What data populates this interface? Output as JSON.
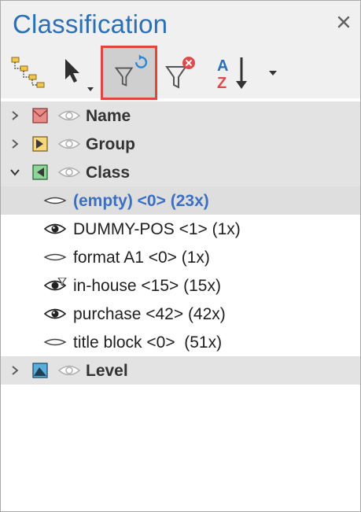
{
  "panel": {
    "title": "Classification"
  },
  "toolbar": {
    "icons": [
      "hierarchy-icon",
      "select-cursor-icon",
      "filter-refresh-icon",
      "filter-clear-icon",
      "sort-az-icon",
      "dropdown-arrow-icon"
    ],
    "sort_letters": {
      "a": "A",
      "z": "Z"
    }
  },
  "tree": {
    "categories": [
      {
        "label": "Name",
        "expanded": false,
        "color": "#d9534f"
      },
      {
        "label": "Group",
        "expanded": false,
        "color": "#f0c040"
      },
      {
        "label": "Class",
        "expanded": true,
        "color": "#3fae49"
      },
      {
        "label": "Level",
        "expanded": false,
        "color": "#2e8fc7"
      }
    ],
    "class_items": [
      {
        "label": "(empty) <0> (23x)",
        "eye": "closed",
        "selected": true
      },
      {
        "label": "DUMMY-POS <1> (1x)",
        "eye": "open"
      },
      {
        "label": "format A1 <0> (1x)",
        "eye": "closed"
      },
      {
        "label": "in-house <15> (15x)",
        "eye": "filtered"
      },
      {
        "label": "purchase <42> (42x)",
        "eye": "open"
      },
      {
        "label": "title block <0>  (51x)",
        "eye": "closed"
      }
    ]
  }
}
